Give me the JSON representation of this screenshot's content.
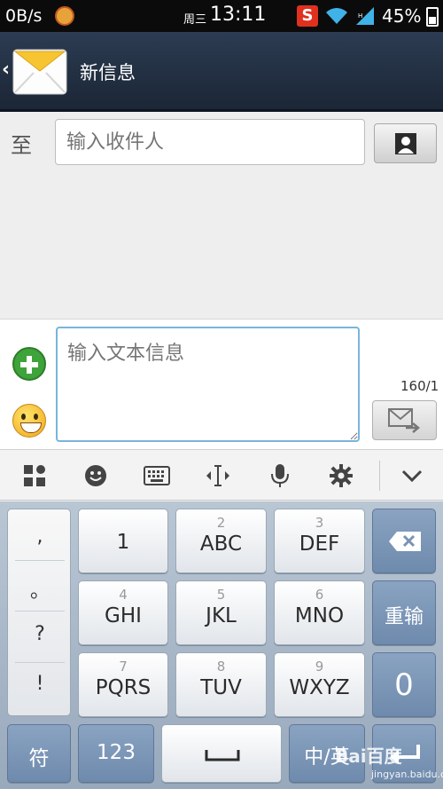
{
  "status_bar": {
    "net_speed": "0B/s",
    "weekday": "周三",
    "time": "13:11",
    "battery": "45%",
    "ime_badge": "S"
  },
  "action_bar": {
    "title": "新信息",
    "back": "‹"
  },
  "recipient": {
    "label": "至",
    "placeholder": "输入收件人"
  },
  "compose": {
    "placeholder": "输入文本信息",
    "char_count": "160/1"
  },
  "ime_toolbar": {
    "icons": [
      "grid-icon",
      "emoji-icon",
      "keyboard-icon",
      "cursor-icon",
      "mic-icon",
      "gear-icon",
      "chevron-down-icon"
    ]
  },
  "keyboard": {
    "punct": [
      ",",
      "。",
      "?",
      "!"
    ],
    "keys": [
      {
        "num": "",
        "label": "1"
      },
      {
        "num": "2",
        "label": "ABC"
      },
      {
        "num": "3",
        "label": "DEF"
      },
      {
        "num": "4",
        "label": "GHI"
      },
      {
        "num": "5",
        "label": "JKL"
      },
      {
        "num": "6",
        "label": "MNO"
      },
      {
        "num": "7",
        "label": "PQRS"
      },
      {
        "num": "8",
        "label": "TUV"
      },
      {
        "num": "9",
        "label": "WXYZ"
      }
    ],
    "retype": "重输",
    "zero": "0",
    "symbols": "符",
    "numbers": "123",
    "lang": "中/英"
  },
  "watermark": {
    "brand": "Bai百度",
    "sub": "jingyan.baidu.com"
  }
}
